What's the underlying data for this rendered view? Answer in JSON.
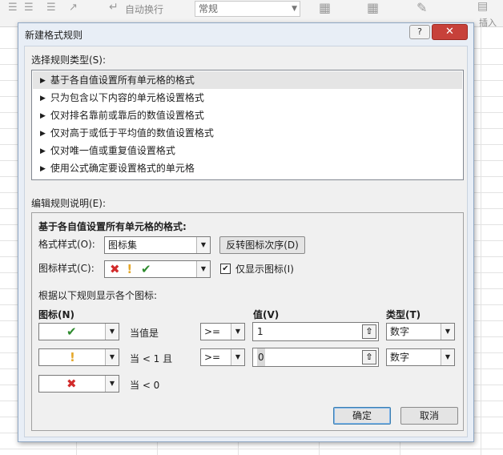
{
  "dialog": {
    "title": "新建格式规则",
    "help": "?",
    "close": "✕"
  },
  "ribbon": {
    "wrap_text": "自动换行",
    "number_format": "常规",
    "side_text": "插入"
  },
  "rule_type": {
    "label": "选择规则类型(S):",
    "items": [
      "基于各自值设置所有单元格的格式",
      "只为包含以下内容的单元格设置格式",
      "仅对排名靠前或靠后的数值设置格式",
      "仅对高于或低于平均值的数值设置格式",
      "仅对唯一值或重复值设置格式",
      "使用公式确定要设置格式的单元格"
    ],
    "selected_index": 0
  },
  "edit": {
    "label": "编辑规则说明(E):",
    "heading": "基于各自值设置所有单元格的格式:",
    "format_style_label": "格式样式(O):",
    "format_style_value": "图标集",
    "reverse_button": "反转图标次序(D)",
    "icon_style_label": "图标样式(C):",
    "show_icon_only_label": "仅显示图标(I)",
    "show_icon_only_checked": true,
    "rule_intro": "根据以下规则显示各个图标:",
    "col_icon": "图标(N)",
    "col_value": "值(V)",
    "col_type": "类型(T)",
    "rows": [
      {
        "icon": "green-check",
        "condition": "当值是",
        "operator": ">=",
        "value": "1",
        "type": "数字"
      },
      {
        "icon": "yellow-exclamation",
        "condition": "当 < 1 且",
        "operator": ">=",
        "value": "0",
        "type": "数字"
      },
      {
        "icon": "red-cross",
        "condition": "当 < 0"
      }
    ]
  },
  "buttons": {
    "ok": "确定",
    "cancel": "取消"
  },
  "colors": {
    "green": "#2e8b2e",
    "yellow": "#e5a82b",
    "red": "#d22b2b",
    "close_button": "#c7413a"
  }
}
